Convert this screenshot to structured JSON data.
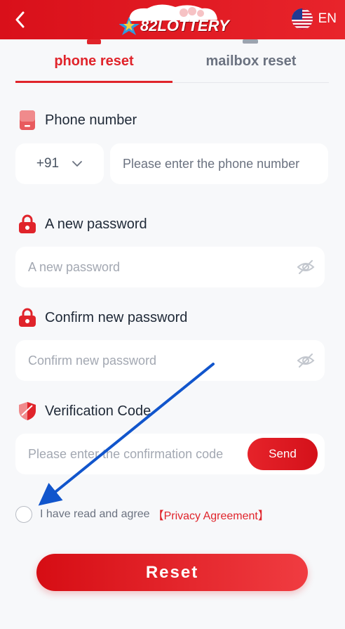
{
  "header": {
    "back_icon": "chevron-left-icon",
    "logo_text": "82LOTTERY",
    "language": "EN",
    "flag_icon": "us-flag-icon"
  },
  "tabs": [
    {
      "label": "phone reset",
      "active": true
    },
    {
      "label": "mailbox reset",
      "active": false
    }
  ],
  "form": {
    "phone_label": "Phone number",
    "country_code": "+91",
    "phone_placeholder": "Please enter the phone number",
    "new_password_label": "A new password",
    "new_password_placeholder": "A new password",
    "confirm_password_label": "Confirm new password",
    "confirm_password_placeholder": "Confirm new password",
    "verification_label": "Verification Code",
    "verification_placeholder": "Please enter the confirmation code",
    "send_label": "Send"
  },
  "agreement": {
    "text": "I have read and agree",
    "link": "【Privacy Agreement】",
    "checked": false
  },
  "reset_label": "Reset",
  "colors": {
    "brand_red": "#e0242b",
    "annotation_arrow": "#1155cc"
  }
}
